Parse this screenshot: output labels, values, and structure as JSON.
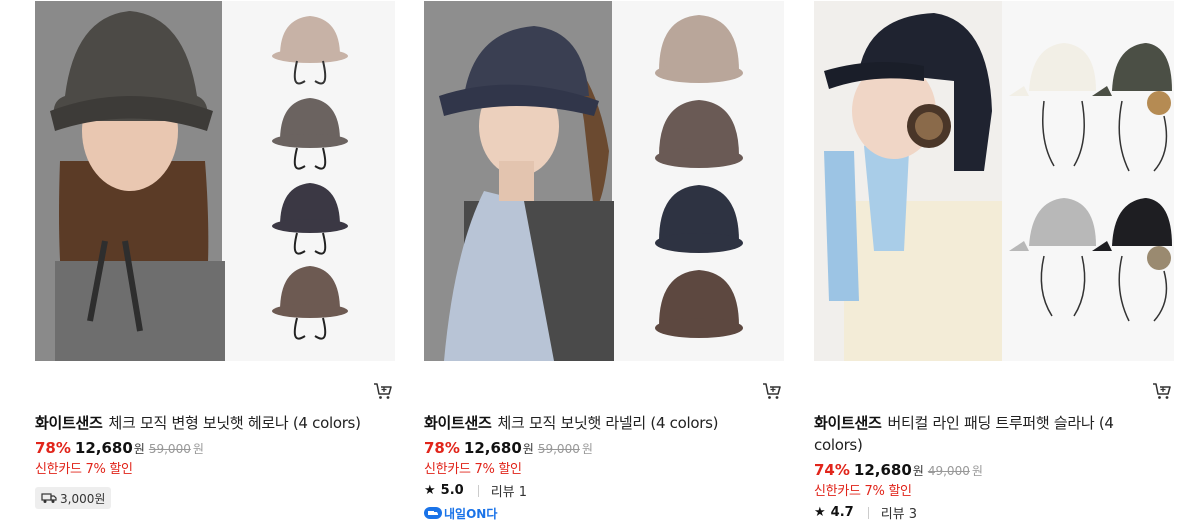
{
  "products": [
    {
      "brand": "화이트샌즈",
      "name": "체크 모직 변형 보닛햇 헤로나 (4 colors)",
      "discount": "78%",
      "price": "12,680",
      "price_unit": "원",
      "original_price": "59,000",
      "original_unit": "원",
      "card_promo": "신한카드 7% 할인",
      "shipping": "3,000원",
      "image": "woman-in-brown-check-bucket-hat-with-four-color-variants",
      "cart_icon": "cart-icon"
    },
    {
      "brand": "화이트샌즈",
      "name": "체크 모직 보닛햇 라넬리 (4 colors)",
      "discount": "78%",
      "price": "12,680",
      "price_unit": "원",
      "original_price": "59,000",
      "original_unit": "원",
      "card_promo": "신한카드 7% 할인",
      "rating": "5.0",
      "review_label": "리뷰 1",
      "delivery_badge": "내일ON다",
      "image": "woman-profile-navy-check-bonnet-hat-with-four-color-variants",
      "cart_icon": "cart-icon"
    },
    {
      "brand": "화이트샌즈",
      "name": "버티컬 라인 패딩 트루퍼햇 슬라나 (4 colors)",
      "discount": "74%",
      "price": "12,680",
      "price_unit": "원",
      "original_price": "49,000",
      "original_unit": "원",
      "card_promo": "신한카드 7% 할인",
      "rating": "4.7",
      "review_label": "리뷰 3",
      "image": "woman-in-black-padded-trooper-hat-with-four-color-variants",
      "cart_icon": "cart-icon"
    }
  ],
  "colors": {
    "discount": "#e1251b",
    "promo": "#e1251b",
    "badge_blue": "#1a73e8",
    "ship_bg": "#eeeeee"
  }
}
